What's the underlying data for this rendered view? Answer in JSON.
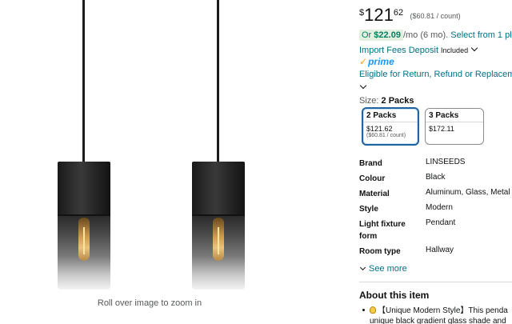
{
  "image": {
    "zoom_hint": "Roll over image to zoom in"
  },
  "price": {
    "symbol": "$",
    "whole": "121",
    "fraction": "62",
    "unit_price": "($60.81 / count)"
  },
  "monthly": {
    "or": "Or",
    "amount": "$22.09",
    "term": "/mo (6 mo).",
    "link": "Select from 1 pla"
  },
  "fees": {
    "link": "Import Fees Deposit",
    "included": "Included"
  },
  "prime": {
    "label": "prime"
  },
  "returns": {
    "link": "Eligible for Return, Refund or Replacemen"
  },
  "size": {
    "label": "Size:",
    "selected": "2 Packs",
    "options": [
      {
        "title": "2 Packs",
        "price": "$121.62",
        "unit": "($60.81 / count)"
      },
      {
        "title": "3 Packs",
        "price": "$172.11",
        "unit": ""
      }
    ]
  },
  "specs": [
    {
      "key": "Brand",
      "value": "LINSEEDS"
    },
    {
      "key": "Colour",
      "value": "Black"
    },
    {
      "key": "Material",
      "value": "Aluminum, Glass, Metal"
    },
    {
      "key": "Style",
      "value": "Modern"
    },
    {
      "key": "Light fixture form",
      "value": "Pendant"
    },
    {
      "key": "Room type",
      "value": "Hallway"
    }
  ],
  "see_more": "See more",
  "about": {
    "title": "About this item",
    "bullet_1_line_1": "【Unique Modern Style】This penda",
    "bullet_1_line_2": "unique black gradient glass shade and"
  },
  "colors": {
    "link": "#007185",
    "prime": "#1399ff",
    "selected_border": "#2162a1",
    "deal_green": "#067d62"
  }
}
